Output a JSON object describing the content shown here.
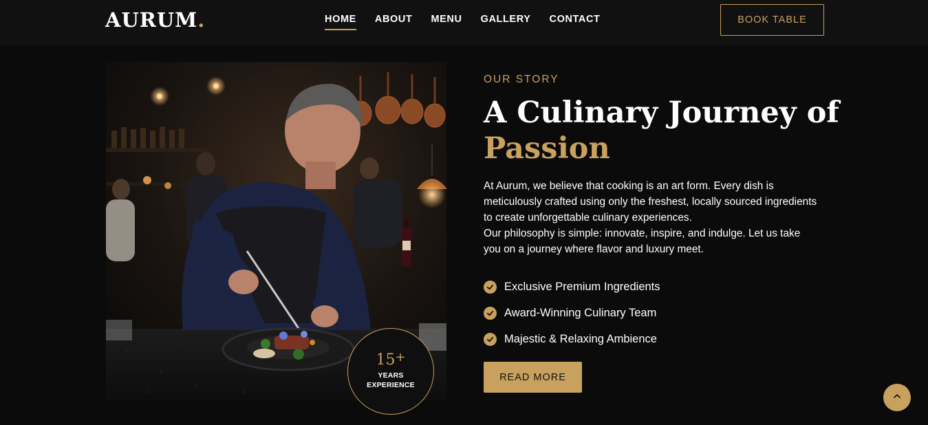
{
  "brand": {
    "name": "AURUM",
    "dot": ".",
    "accent_color": "#c9a15f"
  },
  "nav": {
    "items": [
      {
        "label": "HOME",
        "active": true
      },
      {
        "label": "ABOUT",
        "active": false
      },
      {
        "label": "MENU",
        "active": false
      },
      {
        "label": "GALLERY",
        "active": false
      },
      {
        "label": "CONTACT",
        "active": false
      }
    ],
    "cta_label": "BOOK TABLE"
  },
  "about": {
    "eyebrow": "OUR STORY",
    "title_line1": "A Culinary Journey of",
    "title_accent": "Passion",
    "paragraph1": "At Aurum, we believe that cooking is an art form. Every dish is meticulously crafted using only the freshest, locally sourced ingredients to create unforgettable culinary experiences.",
    "paragraph2": "Our philosophy is simple: innovate, inspire, and indulge. Let us take you on a journey where flavor and luxury meet.",
    "features": [
      "Exclusive Premium Ingredients",
      "Award-Winning Culinary Team",
      "Majestic & Relaxing Ambience"
    ],
    "button_label": "READ MORE",
    "badge": {
      "number": "15",
      "plus": "+",
      "line1": "YEARS",
      "line2": "EXPERIENCE"
    }
  },
  "icons": {
    "feature": "check-circle-icon",
    "scroll_top": "chevron-up-icon"
  }
}
